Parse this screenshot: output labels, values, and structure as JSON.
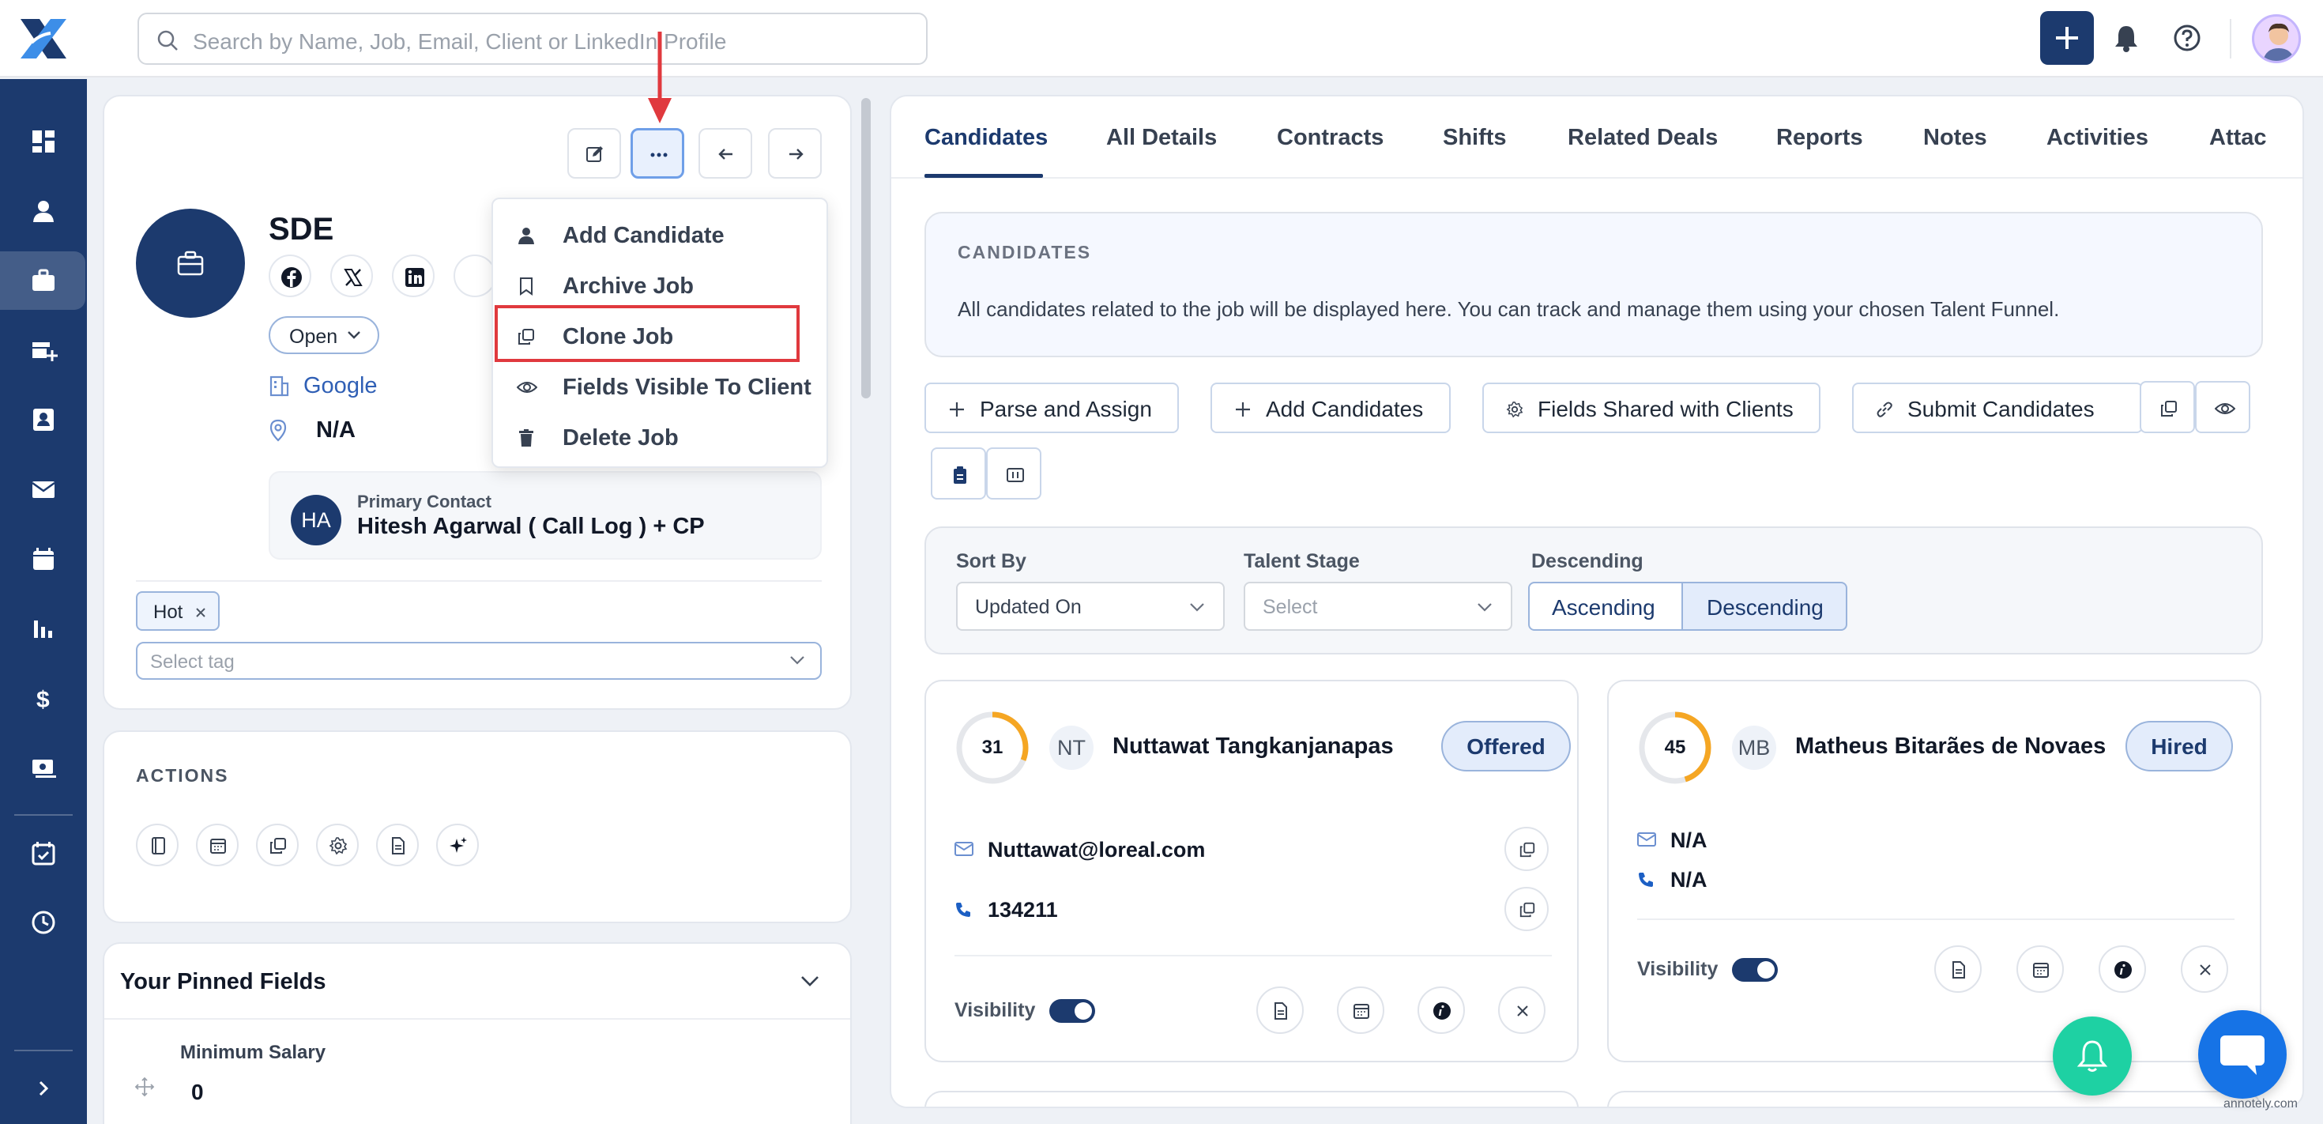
{
  "app": {
    "search_placeholder": "Search by Name, Job, Email, Client or LinkedIn Profile",
    "accent_color": "#1c3a6e",
    "highlight_color": "#e0393e"
  },
  "sidebar": {
    "items": [
      {
        "name": "dashboard",
        "icon": "dashboard-icon",
        "active": false
      },
      {
        "name": "contacts",
        "icon": "person-icon",
        "active": false
      },
      {
        "name": "jobs",
        "icon": "briefcase-icon",
        "active": true
      },
      {
        "name": "deals",
        "icon": "truck-plus-icon",
        "active": false
      },
      {
        "name": "candidates",
        "icon": "id-card-icon",
        "active": false
      },
      {
        "name": "email",
        "icon": "mail-icon",
        "active": false
      },
      {
        "name": "calendar",
        "icon": "calendar-icon",
        "active": false
      },
      {
        "name": "reports",
        "icon": "bar-chart-icon",
        "active": false
      },
      {
        "name": "billing",
        "icon": "dollar-icon",
        "active": false
      },
      {
        "name": "payments",
        "icon": "money-icon",
        "active": false
      },
      {
        "name": "tasks",
        "icon": "calendar-check-icon",
        "active": false
      },
      {
        "name": "history",
        "icon": "clock-icon",
        "active": false
      }
    ]
  },
  "job": {
    "title": "SDE",
    "status": "Open",
    "company": "Google",
    "location": "N/A",
    "primary_contact": {
      "label": "Primary Contact",
      "initials": "HA",
      "name": "Hitesh Agarwal ( Call Log ) + CP"
    },
    "tags": [
      "Hot"
    ],
    "tag_placeholder": "Select tag"
  },
  "job_menu": {
    "items": [
      {
        "label": "Add Candidate",
        "icon": "person-icon"
      },
      {
        "label": "Archive Job",
        "icon": "bookmark-icon"
      },
      {
        "label": "Clone Job",
        "icon": "copy-icon",
        "highlighted": true
      },
      {
        "label": "Fields Visible To Client",
        "icon": "eye-icon"
      },
      {
        "label": "Delete Job",
        "icon": "trash-icon"
      }
    ]
  },
  "actions": {
    "title": "ACTIONS"
  },
  "pinned": {
    "title": "Your Pinned Fields",
    "fields": [
      {
        "label": "Minimum Salary",
        "value": "0"
      }
    ]
  },
  "tabs": [
    "Candidates",
    "All Details",
    "Contracts",
    "Shifts",
    "Related Deals",
    "Reports",
    "Notes",
    "Activities",
    "Attac"
  ],
  "candidates_section": {
    "title": "CANDIDATES",
    "description": "All candidates related to the job will be displayed here. You can track and manage them using your chosen Talent Funnel.",
    "buttons": {
      "parse_assign": "Parse and Assign",
      "add_candidates": "Add Candidates",
      "fields_shared": "Fields Shared with Clients",
      "submit": "Submit Candidates"
    }
  },
  "filters": {
    "sort_by_label": "Sort By",
    "sort_by_value": "Updated On",
    "talent_stage_label": "Talent Stage",
    "talent_stage_placeholder": "Select",
    "order_label": "Descending",
    "ascending": "Ascending",
    "descending": "Descending",
    "selected_order": "Descending"
  },
  "candidates": [
    {
      "score": 31,
      "initials": "NT",
      "name": "Nuttawat Tangkanjanapas",
      "status": "Offered",
      "email": "Nuttawat@loreal.com",
      "phone": "134211",
      "visibility_label": "Visibility",
      "visible": true
    },
    {
      "score": 45,
      "initials": "MB",
      "name": "Matheus Bitarães de Novaes",
      "status": "Hired",
      "email": "N/A",
      "phone": "N/A",
      "visibility_label": "Visibility",
      "visible": true
    }
  ],
  "watermark": "annotely.com"
}
